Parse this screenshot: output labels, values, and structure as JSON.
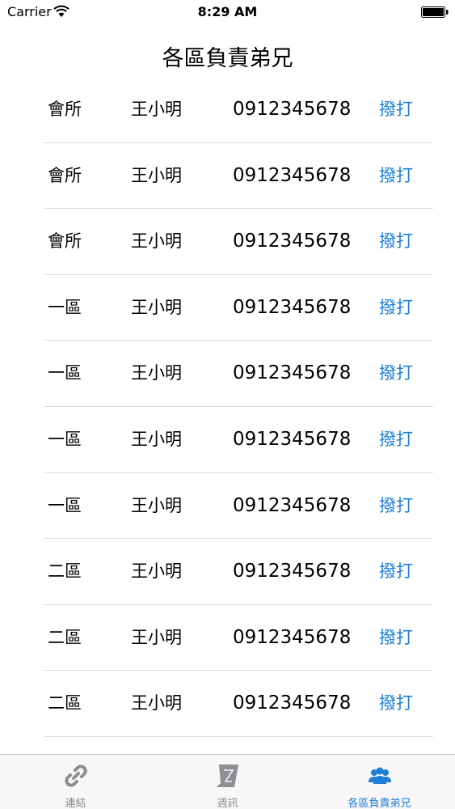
{
  "status_bar": {
    "carrier": "Carrier",
    "time": "8:29 AM"
  },
  "page": {
    "title": "各區負責弟兄"
  },
  "contacts": [
    {
      "area": "會所",
      "name": "王小明",
      "phone": "0912345678",
      "action": "撥打"
    },
    {
      "area": "會所",
      "name": "王小明",
      "phone": "0912345678",
      "action": "撥打"
    },
    {
      "area": "會所",
      "name": "王小明",
      "phone": "0912345678",
      "action": "撥打"
    },
    {
      "area": "一區",
      "name": "王小明",
      "phone": "0912345678",
      "action": "撥打"
    },
    {
      "area": "一區",
      "name": "王小明",
      "phone": "0912345678",
      "action": "撥打"
    },
    {
      "area": "一區",
      "name": "王小明",
      "phone": "0912345678",
      "action": "撥打"
    },
    {
      "area": "一區",
      "name": "王小明",
      "phone": "0912345678",
      "action": "撥打"
    },
    {
      "area": "二區",
      "name": "王小明",
      "phone": "0912345678",
      "action": "撥打"
    },
    {
      "area": "二區",
      "name": "王小明",
      "phone": "0912345678",
      "action": "撥打"
    },
    {
      "area": "二區",
      "name": "王小明",
      "phone": "0912345678",
      "action": "撥打"
    }
  ],
  "tab_bar": {
    "tabs": [
      {
        "label": "連結",
        "icon": "link-icon",
        "active": false
      },
      {
        "label": "週訊",
        "icon": "weekly-news-icon",
        "active": false
      },
      {
        "label": "各區負責弟兄",
        "icon": "people-icon",
        "active": true
      }
    ]
  },
  "colors": {
    "accent": "#1e7fd6",
    "inactive_tab": "#8e8e93",
    "divider": "#dcdcdc"
  }
}
